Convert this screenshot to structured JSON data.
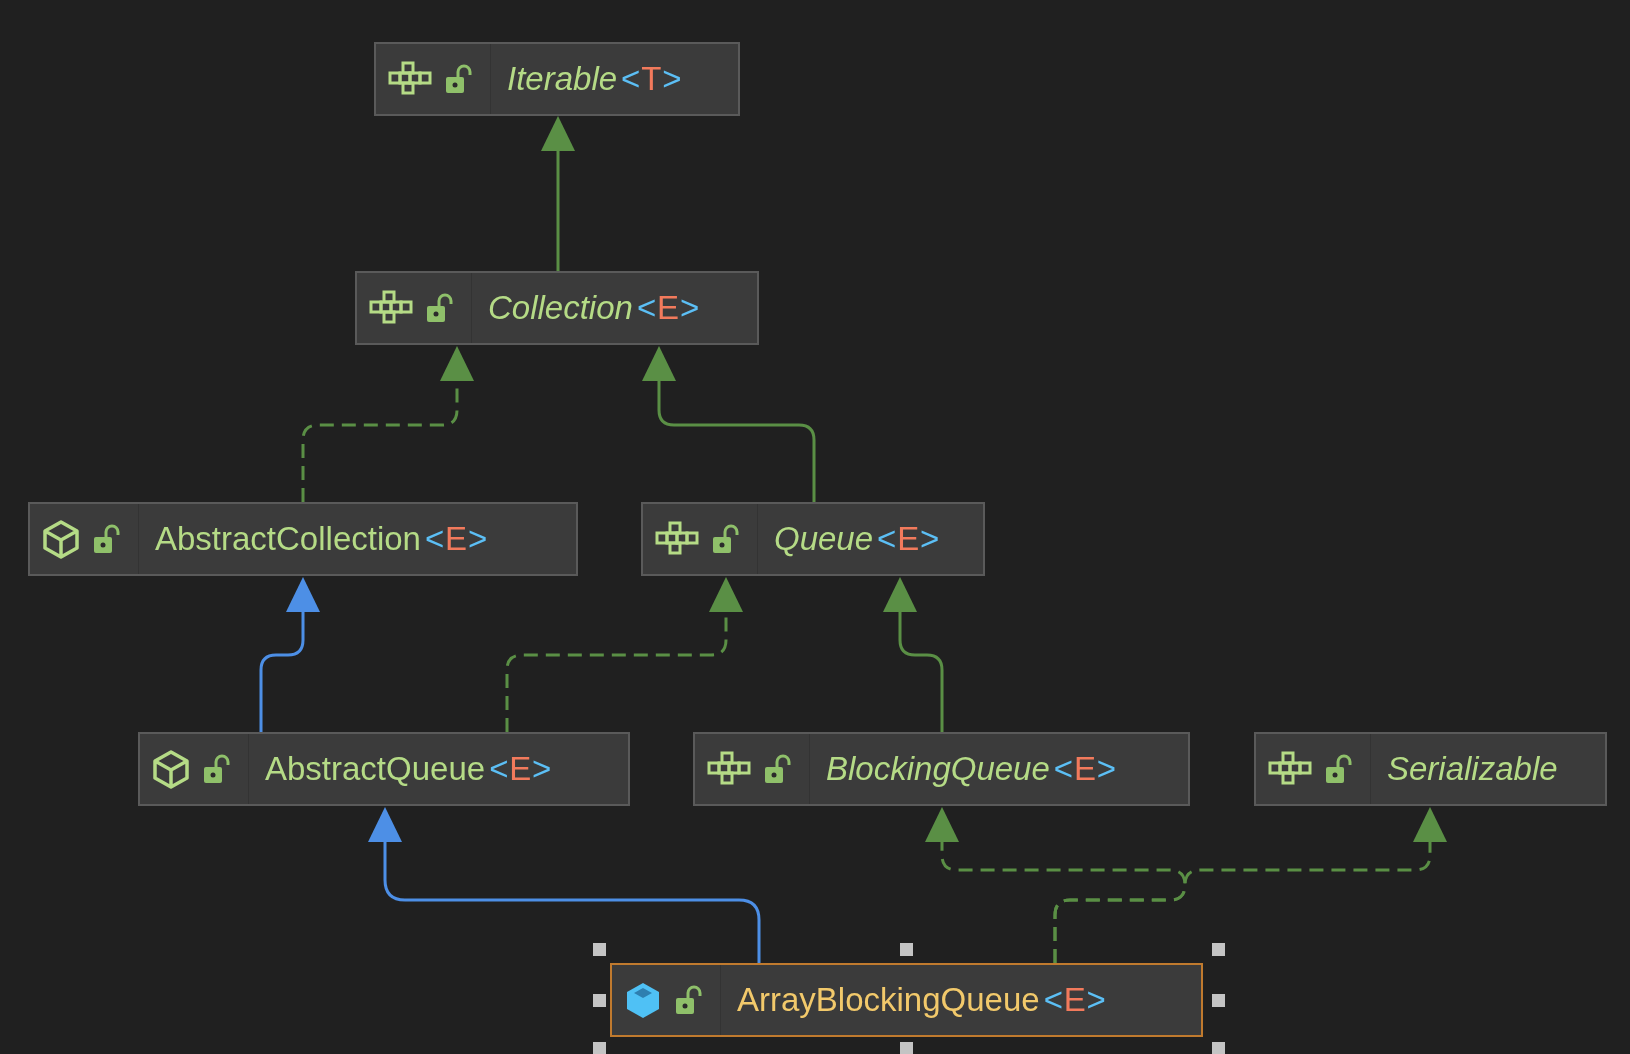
{
  "nodes": [
    {
      "kind": "interface",
      "name": "Iterable",
      "type_param": {
        "open": "<",
        "name": "T",
        "close": ">"
      },
      "selected": false
    },
    {
      "kind": "interface",
      "name": "Collection",
      "type_param": {
        "open": "<",
        "name": "E",
        "close": ">"
      },
      "selected": false
    },
    {
      "kind": "abstract_class",
      "name": "AbstractCollection",
      "type_param": {
        "open": "<",
        "name": "E",
        "close": ">"
      },
      "selected": false
    },
    {
      "kind": "interface",
      "name": "Queue",
      "type_param": {
        "open": "<",
        "name": "E",
        "close": ">"
      },
      "selected": false
    },
    {
      "kind": "abstract_class",
      "name": "AbstractQueue",
      "type_param": {
        "open": "<",
        "name": "E",
        "close": ">"
      },
      "selected": false
    },
    {
      "kind": "interface",
      "name": "BlockingQueue",
      "type_param": {
        "open": "<",
        "name": "E",
        "close": ">"
      },
      "selected": false
    },
    {
      "kind": "interface",
      "name": "Serializable",
      "selected": false
    },
    {
      "kind": "class",
      "name": "ArrayBlockingQueue",
      "type_param": {
        "open": "<",
        "name": "E",
        "close": ">"
      },
      "selected": true
    }
  ],
  "edges": [
    {
      "kind": "extends"
    },
    {
      "kind": "implements"
    },
    {
      "kind": "extends"
    },
    {
      "kind": "class_extends"
    },
    {
      "kind": "implements"
    },
    {
      "kind": "extends"
    },
    {
      "kind": "class_extends"
    },
    {
      "kind": "implements"
    },
    {
      "kind": "implements"
    }
  ]
}
